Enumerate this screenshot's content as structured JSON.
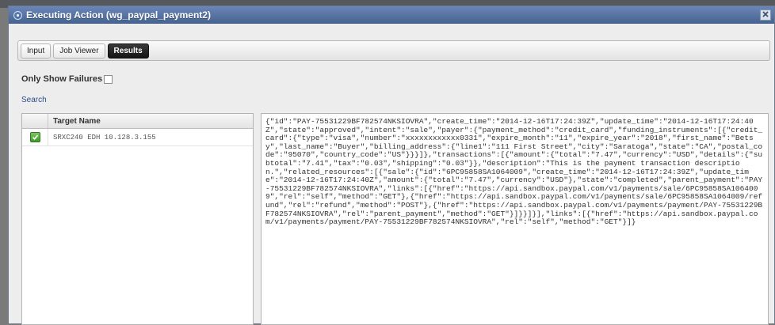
{
  "window": {
    "title": "Executing Action (wg_paypal_payment2)",
    "close_icon": "close-icon"
  },
  "tabs": [
    {
      "label": "Input",
      "active": false
    },
    {
      "label": "Job Viewer",
      "active": false
    },
    {
      "label": "Results",
      "active": true
    }
  ],
  "filters": {
    "only_show_failures_label": "Only Show Failures",
    "only_show_failures_checked": false,
    "search_label": "Search"
  },
  "results_table": {
    "column_header": "Target Name",
    "rows": [
      {
        "status": "success",
        "status_icon": "checkmark-icon",
        "name": "SRXC240 EDH 10.128.3.155"
      }
    ]
  },
  "result_output": "{\"id\":\"PAY-75531229BF782574NKSIOVRA\",\"create_time\":\"2014-12-16T17:24:39Z\",\"update_time\":\"2014-12-16T17:24:40Z\",\"state\":\"approved\",\"intent\":\"sale\",\"payer\":{\"payment_method\":\"credit_card\",\"funding_instruments\":[{\"credit_card\":{\"type\":\"visa\",\"number\":\"xxxxxxxxxxxx0331\",\"expire_month\":\"11\",\"expire_year\":\"2018\",\"first_name\":\"Betsy\",\"last_name\":\"Buyer\",\"billing_address\":{\"line1\":\"111 First Street\",\"city\":\"Saratoga\",\"state\":\"CA\",\"postal_code\":\"95070\",\"country_code\":\"US\"}}}]},\"transactions\":[{\"amount\":{\"total\":\"7.47\",\"currency\":\"USD\",\"details\":{\"subtotal\":\"7.41\",\"tax\":\"0.03\",\"shipping\":\"0.03\"}},\"description\":\"This is the payment transaction description.\",\"related_resources\":[{\"sale\":{\"id\":\"6PC95858SA1064009\",\"create_time\":\"2014-12-16T17:24:39Z\",\"update_time\":\"2014-12-16T17:24:40Z\",\"amount\":{\"total\":\"7.47\",\"currency\":\"USD\"},\"state\":\"completed\",\"parent_payment\":\"PAY-75531229BF782574NKSIOVRA\",\"links\":[{\"href\":\"https://api.sandbox.paypal.com/v1/payments/sale/6PC95858SA1064009\",\"rel\":\"self\",\"method\":\"GET\"},{\"href\":\"https://api.sandbox.paypal.com/v1/payments/sale/6PC95858SA1064009/refund\",\"rel\":\"refund\",\"method\":\"POST\"},{\"href\":\"https://api.sandbox.paypal.com/v1/payments/payment/PAY-75531229BF782574NKSIOVRA\",\"rel\":\"parent_payment\",\"method\":\"GET\"}]}}]}],\"links\":[{\"href\":\"https://api.sandbox.paypal.com/v1/payments/payment/PAY-75531229BF782574NKSIOVRA\",\"rel\":\"self\",\"method\":\"GET\"}]}",
  "colors": {
    "titlebar": "#4f6fa3",
    "active_tab": "#1f1f1f",
    "success": "#4caf32",
    "link": "#2a4e8a"
  }
}
